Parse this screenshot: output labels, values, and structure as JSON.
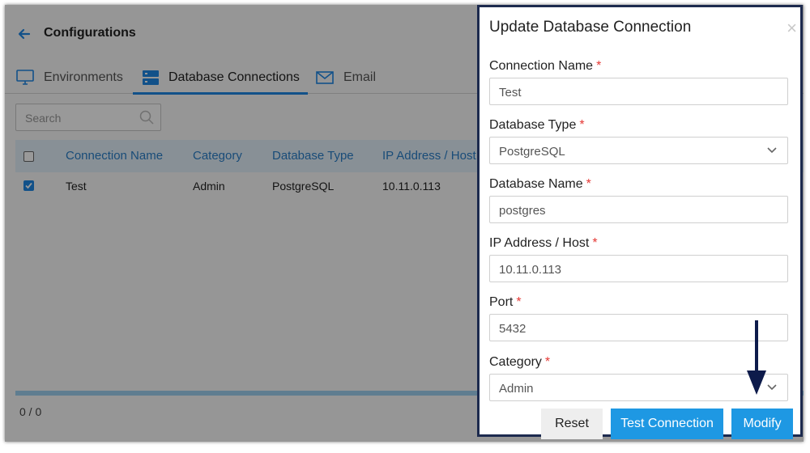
{
  "header": {
    "title": "Configurations",
    "back_icon": "arrow-left-icon"
  },
  "tabs": [
    {
      "label": "Environments",
      "icon": "monitor-icon"
    },
    {
      "label": "Database Connections",
      "icon": "server-icon",
      "active": true
    },
    {
      "label": "Email",
      "icon": "envelope-icon"
    }
  ],
  "search": {
    "placeholder": "Search"
  },
  "table": {
    "columns": [
      "Connection Name",
      "Category",
      "Database Type",
      "IP Address / Host"
    ],
    "rows": [
      {
        "selected": true,
        "cells": [
          "Test",
          "Admin",
          "PostgreSQL",
          "10.11.0.113"
        ]
      }
    ]
  },
  "footer": {
    "count": "0 / 0"
  },
  "modal": {
    "title": "Update Database Connection",
    "close": "×",
    "fields": [
      {
        "label": "Connection Name",
        "required": "*",
        "value": "Test",
        "type": "text"
      },
      {
        "label": "Database Type",
        "required": "*",
        "value": "PostgreSQL",
        "type": "select"
      },
      {
        "label": "Database Name",
        "required": "*",
        "value": "postgres",
        "type": "text"
      },
      {
        "label": "IP Address / Host",
        "required": "*",
        "value": "10.11.0.113",
        "type": "text"
      },
      {
        "label": "Port",
        "required": "*",
        "value": "5432",
        "type": "text"
      },
      {
        "label": "Category",
        "required": "*",
        "value": "Admin",
        "type": "select"
      }
    ],
    "buttons": {
      "reset": "Reset",
      "test": "Test Connection",
      "modify": "Modify"
    }
  },
  "colors": {
    "accent": "#1e98e3",
    "frame": "#1c2a4e",
    "annotation_arrow": "#0d1b4b"
  }
}
